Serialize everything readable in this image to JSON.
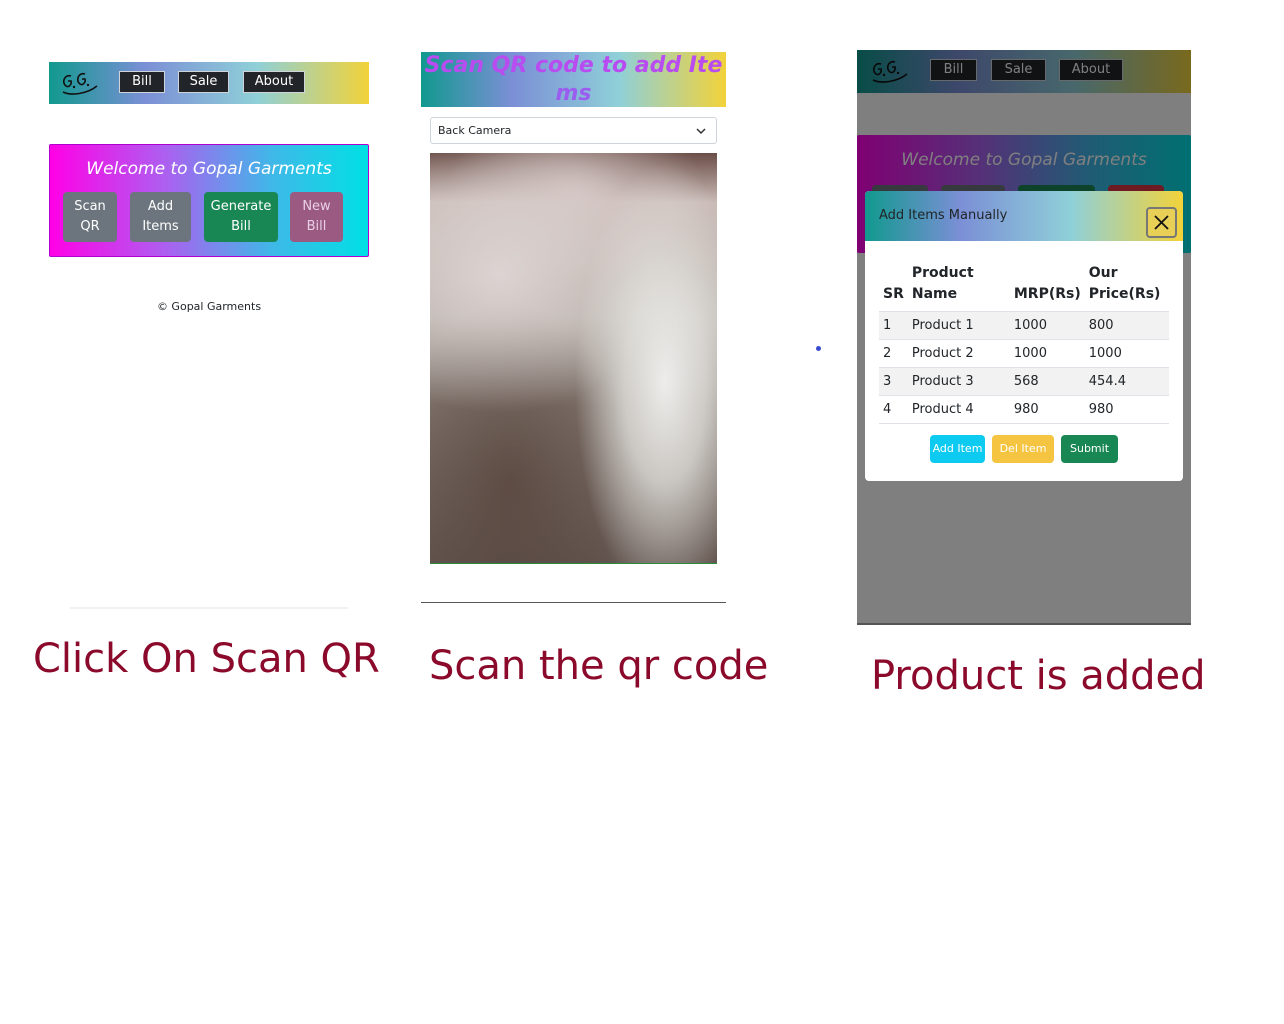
{
  "panel1": {
    "nav": {
      "bill": "Bill",
      "sale": "Sale",
      "about": "About"
    },
    "welcome": "Welcome to Gopal Garments",
    "buttons": {
      "scan_qr": [
        "Scan",
        "QR"
      ],
      "add_items": [
        "Add",
        "Items"
      ],
      "generate_bill": [
        "Generate",
        "Bill"
      ],
      "new_bill": [
        "New",
        "Bill"
      ]
    },
    "footer": "© Gopal Garments",
    "caption": "Click On Scan QR"
  },
  "panel2": {
    "header_line1": "Scan QR code to add Ite",
    "header_line2": "ms",
    "camera_select": "Back Camera",
    "caption": "Scan the qr code"
  },
  "panel3": {
    "nav": {
      "bill": "Bill",
      "sale": "Sale",
      "about": "About"
    },
    "welcome": "Welcome to Gopal Garments",
    "modal": {
      "title": "Add Items Manually",
      "headers": {
        "sr": "SR",
        "name_1": "Product",
        "name_2": "Name",
        "mrp": "MRP(Rs)",
        "price_1": "Our",
        "price_2": "Price(Rs)"
      },
      "rows": [
        {
          "sr": "1",
          "name": "Product 1",
          "mrp": "1000",
          "price": "800"
        },
        {
          "sr": "2",
          "name": "Product 2",
          "mrp": "1000",
          "price": "1000"
        },
        {
          "sr": "3",
          "name": "Product 3",
          "mrp": "568",
          "price": "454.4"
        },
        {
          "sr": "4",
          "name": "Product 4",
          "mrp": "980",
          "price": "980"
        }
      ],
      "add_item": "Add Item",
      "del_item": "Del Item",
      "submit": "Submit"
    },
    "caption": "Product is added"
  },
  "colors": {
    "caption": "#8b0a2b",
    "nav_button": "#212529",
    "scan_button": "#6c757d",
    "generate_button": "#198754",
    "add_item_button": "#0dcaf0",
    "del_item_button": "#f5c542",
    "submit_button": "#198754"
  },
  "icons": {
    "logo": "gg-logo",
    "close": "close-icon",
    "dropdown": "chevron-down-icon"
  }
}
